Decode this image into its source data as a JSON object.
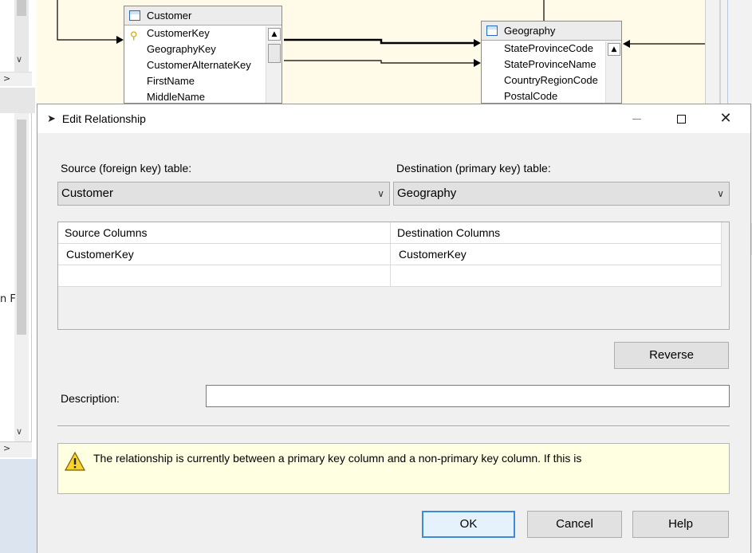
{
  "diagram": {
    "customer_table": {
      "title": "Customer",
      "columns": [
        "CustomerKey",
        "GeographyKey",
        "CustomerAlternateKey",
        "FirstName",
        "MiddleName"
      ],
      "primary_key": "CustomerKey"
    },
    "geography_table": {
      "title": "Geography",
      "columns": [
        "StateProvinceCode",
        "StateProvinceName",
        "CountryRegionCode",
        "PostalCode"
      ]
    }
  },
  "left_pane": {
    "truncated_text": "n F"
  },
  "dialog": {
    "title": "Edit Relationship",
    "source_label": "Source (foreign key) table:",
    "source_value": "Customer",
    "destination_label": "Destination (primary key) table:",
    "destination_value": "Geography",
    "grid": {
      "headers": [
        "Source Columns",
        "Destination Columns"
      ],
      "rows": [
        [
          "CustomerKey",
          "CustomerKey"
        ],
        [
          "",
          ""
        ]
      ]
    },
    "reverse_label": "Reverse",
    "description_label": "Description:",
    "description_value": "",
    "warning_text": "The relationship is currently between a primary key column and a non-primary key column. If this is",
    "ok_label": "OK",
    "cancel_label": "Cancel",
    "help_label": "Help"
  },
  "colors": {
    "canvas": "#fffbe8",
    "warning_bg": "#ffffe1",
    "primary_border": "#3c8bd9"
  }
}
